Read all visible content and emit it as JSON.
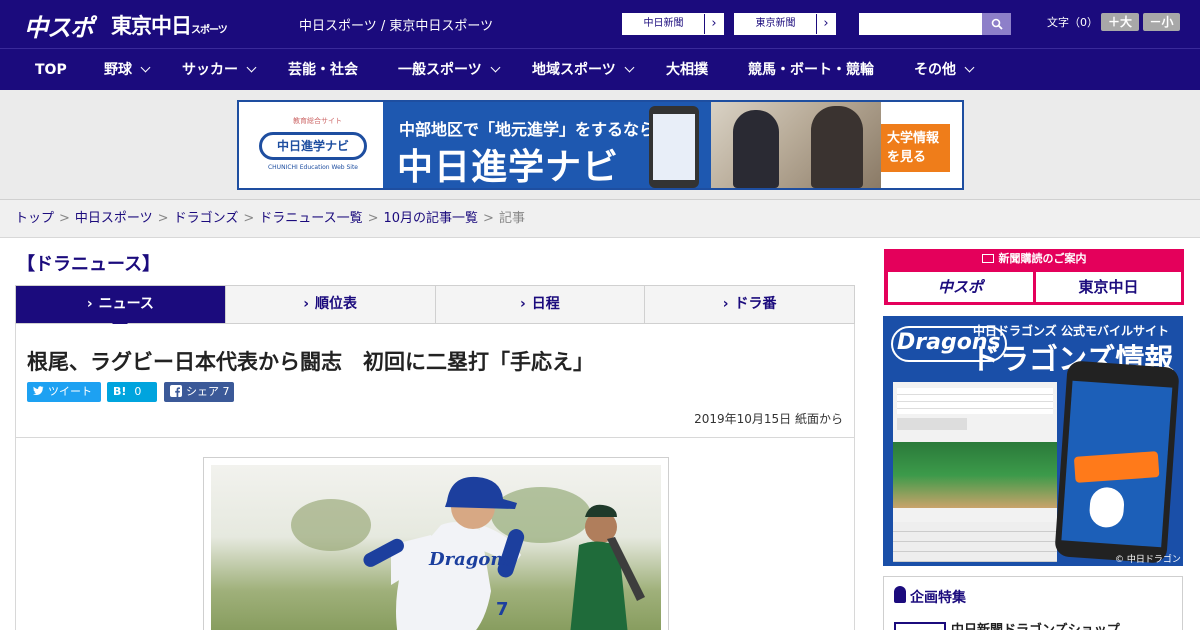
{
  "header": {
    "logo_chuspo": "中スポ",
    "logo_tokyo": "東京中日",
    "logo_tokyo_small": "スポーツ",
    "site_title": "中日スポーツ / 東京中日スポーツ",
    "site_buttons": [
      "中日新聞",
      "東京新聞"
    ],
    "search_placeholder": "",
    "font_size_label": "文字（0）",
    "font_bigger": "＋大",
    "font_smaller": "－小",
    "brand_color": "#1b0b7d"
  },
  "nav": {
    "items": [
      "TOP",
      "野球",
      "サッカー",
      "芸能・社会",
      "一般スポーツ",
      "地域スポーツ",
      "大相撲",
      "競馬・ボート・競輪",
      "その他"
    ]
  },
  "banner": {
    "logo_tag": "教育総合サイト",
    "logo_text": "中日進学ナビ",
    "logo_en": "CHUNICHI Education Web Site",
    "subtitle": "中部地区で「地元進学」をするなら",
    "title": "中日進学ナビ",
    "cta": "大学情報を見る"
  },
  "breadcrumb": [
    "トップ",
    "中日スポーツ",
    "ドラゴンズ",
    "ドラニュース一覧",
    "10月の記事一覧",
    "記事"
  ],
  "main": {
    "section_title": "【ドラニュース】",
    "tabs": [
      "ニュース",
      "順位表",
      "日程",
      "ドラ番"
    ],
    "headline": "根尾、ラグビー日本代表から闘志　初回に二塁打「手応え」",
    "share": {
      "tweet": "ツイート",
      "hatena_label": "B!",
      "hatena_count": "0",
      "facebook_label": "シェア",
      "facebook_count": "7"
    },
    "dateline": "2019年10月15日 紙面から",
    "photo_jersey_text": "Dragons"
  },
  "sidebar": {
    "subscribe_header": "新聞購読のご案内",
    "subscribe_left": "中スポ",
    "subscribe_right": "東京中日",
    "dragons_brand": "Dragons",
    "dragons_subtitle": "中日ドラゴンズ 公式モバイルサイト",
    "dragons_title": "ドラゴンズ情報",
    "dragons_footer": "© 中日ドラゴンズ",
    "feature_title": "企画特集",
    "feature_item": "中日新聞ドラゴンズショップ"
  }
}
